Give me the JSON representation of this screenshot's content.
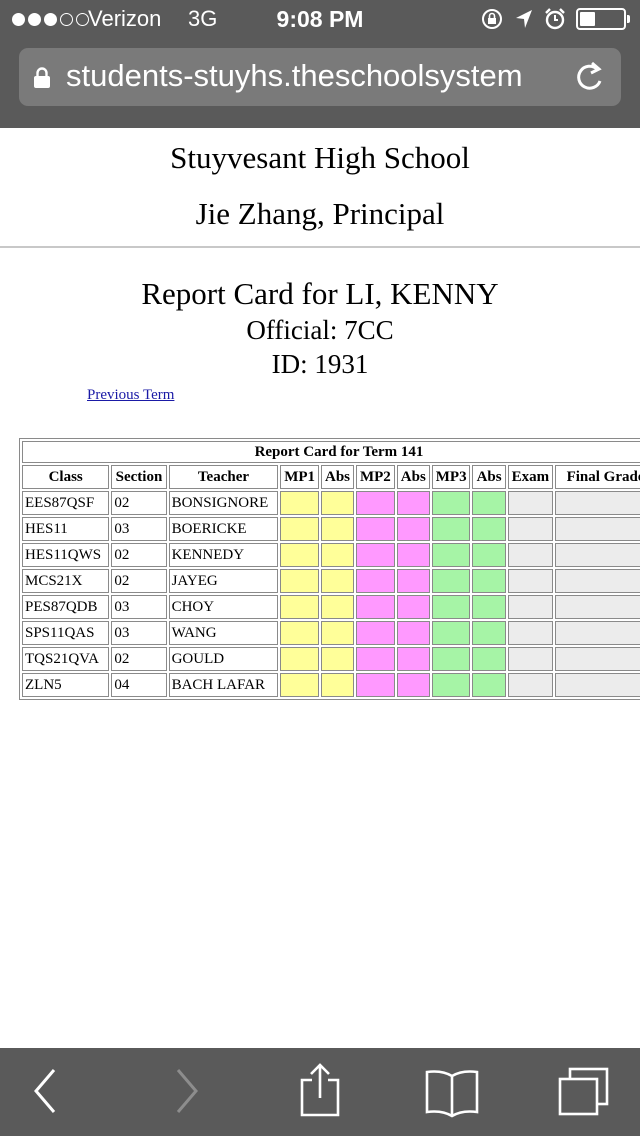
{
  "status_bar": {
    "carrier": "Verizon",
    "network": "3G",
    "time": "9:08 PM",
    "signal_bars_filled": 3,
    "signal_bars_total": 5,
    "battery_level": 0.35
  },
  "browser": {
    "url": "students-stuyhs.theschoolsystem"
  },
  "page": {
    "school_name": "Stuyvesant High School",
    "principal": "Jie Zhang, Principal",
    "report_title": "Report Card for LI, KENNY",
    "official": "Official: 7CC",
    "id": "ID: 1931",
    "previous_term_link": "Previous Term"
  },
  "table": {
    "caption": "Report Card for Term 141",
    "headers": [
      "Class",
      "Section",
      "Teacher",
      "MP1",
      "Abs",
      "MP2",
      "Abs",
      "MP3",
      "Abs",
      "Exam",
      "Final Grade"
    ],
    "rows": [
      {
        "class": "EES87QSF",
        "section": "02",
        "teacher": "BONSIGNORE"
      },
      {
        "class": "HES11",
        "section": "03",
        "teacher": "BOERICKE"
      },
      {
        "class": "HES11QWS",
        "section": "02",
        "teacher": "KENNEDY"
      },
      {
        "class": "MCS21X",
        "section": "02",
        "teacher": "JAYEG"
      },
      {
        "class": "PES87QDB",
        "section": "03",
        "teacher": "CHOY"
      },
      {
        "class": "SPS11QAS",
        "section": "03",
        "teacher": "WANG"
      },
      {
        "class": "TQS21QVA",
        "section": "02",
        "teacher": "GOULD"
      },
      {
        "class": "ZLN5",
        "section": "04",
        "teacher": "BACH LAFAR"
      }
    ]
  },
  "colors": {
    "mp1": "#ffff99",
    "mp2": "#ff99ff",
    "mp3": "#a6f4a6",
    "exam": "#ececec",
    "link": "#1a1aa6",
    "chrome": "#5a5a5a"
  },
  "icons": {
    "lock": "lock-icon",
    "reload": "reload-icon",
    "back": "back-icon",
    "forward": "forward-icon",
    "share": "share-icon",
    "bookmarks": "bookmarks-icon",
    "tabs": "tabs-icon"
  }
}
